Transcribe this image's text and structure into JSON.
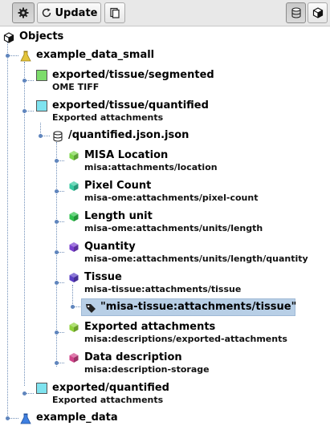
{
  "toolbar": {
    "settings_icon": "gear-icon",
    "update_label": "Update",
    "update_icon": "refresh-icon",
    "copy_icon": "clipboard-icon",
    "database_icon": "database-icon",
    "cube_icon": "cube-icon"
  },
  "tree": {
    "root_label": "Objects",
    "sample_label": "example_data_small",
    "segmented": {
      "title": "exported/tissue/segmented",
      "subtitle": "OME TIFF",
      "color": "#7ddc6b"
    },
    "quantified": {
      "title": "exported/tissue/quantified",
      "subtitle": "Exported attachments",
      "color": "#7fe3ef"
    },
    "json_file": "/quantified.json.json",
    "attachments": [
      {
        "title": "MISA Location",
        "subtitle": "misa:attachments/location",
        "color": "#7cd64a"
      },
      {
        "title": "Pixel Count",
        "subtitle": "misa-ome:attachments/pixel-count",
        "color": "#36c9a0"
      },
      {
        "title": "Length unit",
        "subtitle": "misa-ome:attachments/units/length",
        "color": "#2fc24d"
      },
      {
        "title": "Quantity",
        "subtitle": "misa-ome:attachments/units/length/quantity",
        "color": "#7a3fd0"
      },
      {
        "title": "Tissue",
        "subtitle": "misa-tissue:attachments/tissue",
        "color": "#5b3fc6"
      }
    ],
    "tag_value": "\"misa-tissue:attachments/tissue\"",
    "attachments2": [
      {
        "title": "Exported attachments",
        "subtitle": "misa:descriptions/exported-attachments",
        "color": "#8fd23a"
      },
      {
        "title": "Data description",
        "subtitle": "misa:description-storage",
        "color": "#d1448a"
      }
    ],
    "quantified2": {
      "title": "exported/quantified",
      "subtitle": "Exported attachments",
      "color": "#7fe3ef"
    },
    "sample2_label": "example_data"
  }
}
